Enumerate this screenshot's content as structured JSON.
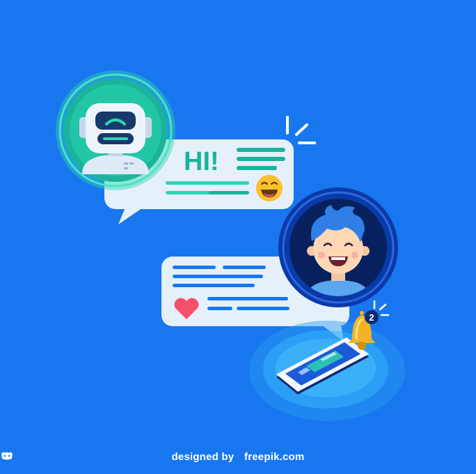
{
  "illustration": {
    "bot_bubble": {
      "greeting": "HI!"
    },
    "notification": {
      "badge_count": "2"
    }
  },
  "credit": {
    "prefix": "designed by",
    "brand": "freepik.com"
  },
  "colors": {
    "background": "#1877ee",
    "bubble": "#e6f0fb",
    "teal": "#1bb39a",
    "bot_ring": "#2fd3b3",
    "user_ring": "#0a3aa8",
    "emoji": "#fdbf2d",
    "heart": "#f5516d",
    "bell": "#f5b222"
  }
}
